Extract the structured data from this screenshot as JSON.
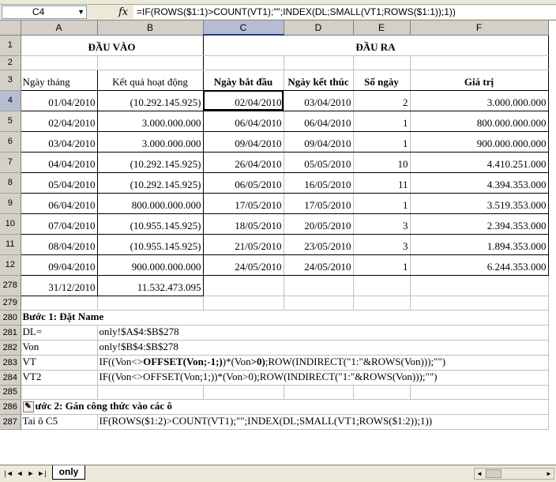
{
  "name_box": "C4",
  "formula_bar_prefix": "fx",
  "formula": "=IF(ROWS($1:1)>COUNT(VT1);\"\";INDEX(DL;SMALL(VT1;ROWS($1:1));1))",
  "columns": [
    "A",
    "B",
    "C",
    "D",
    "E",
    "F"
  ],
  "rows": {
    "r1": {
      "num": "1",
      "a_b": "ĐẦU VÀO",
      "c_f": "ĐẦU RA"
    },
    "r2": {
      "num": "2"
    },
    "r3": {
      "num": "3",
      "a": "Ngày tháng",
      "b": "Kết quả hoạt động",
      "c": "Ngày bắt đầu",
      "d": "Ngày kết thúc",
      "e": "Số ngày",
      "f": "Giá trị"
    },
    "data": [
      {
        "num": "4",
        "a": "01/04/2010",
        "b": "(10.292.145.925)",
        "c": "02/04/2010",
        "d": "03/04/2010",
        "e": "2",
        "f": "3.000.000.000"
      },
      {
        "num": "5",
        "a": "02/04/2010",
        "b": "3.000.000.000",
        "c": "06/04/2010",
        "d": "06/04/2010",
        "e": "1",
        "f": "800.000.000.000"
      },
      {
        "num": "6",
        "a": "03/04/2010",
        "b": "3.000.000.000",
        "c": "09/04/2010",
        "d": "09/04/2010",
        "e": "1",
        "f": "900.000.000.000"
      },
      {
        "num": "7",
        "a": "04/04/2010",
        "b": "(10.292.145.925)",
        "c": "26/04/2010",
        "d": "05/05/2010",
        "e": "10",
        "f": "4.410.251.000"
      },
      {
        "num": "8",
        "a": "05/04/2010",
        "b": "(10.292.145.925)",
        "c": "06/05/2010",
        "d": "16/05/2010",
        "e": "11",
        "f": "4.394.353.000"
      },
      {
        "num": "9",
        "a": "06/04/2010",
        "b": "800.000.000.000",
        "c": "17/05/2010",
        "d": "17/05/2010",
        "e": "1",
        "f": "3.519.353.000"
      },
      {
        "num": "10",
        "a": "07/04/2010",
        "b": "(10.955.145.925)",
        "c": "18/05/2010",
        "d": "20/05/2010",
        "e": "3",
        "f": "2.394.353.000"
      },
      {
        "num": "11",
        "a": "08/04/2010",
        "b": "(10.955.145.925)",
        "c": "21/05/2010",
        "d": "23/05/2010",
        "e": "3",
        "f": "1.894.353.000"
      },
      {
        "num": "12",
        "a": "09/04/2010",
        "b": "900.000.000.000",
        "c": "24/05/2010",
        "d": "24/05/2010",
        "e": "1",
        "f": "6.244.353.000"
      }
    ],
    "r278": {
      "num": "278",
      "a": "31/12/2010",
      "b": "11.532.473.095"
    },
    "r279": {
      "num": "279"
    },
    "r280": {
      "num": "280",
      "a": "Bước 1: Đặt Name"
    },
    "r281": {
      "num": "281",
      "a": "DL=",
      "b": "only!$A$4:$B$278"
    },
    "r282": {
      "num": "282",
      "a": "Von",
      "b": "only!$B$4:$B$278"
    },
    "r283": {
      "num": "283",
      "a": "VT",
      "b_pre": "IF((Von<>",
      "b_bold1": "OFFSET(Von;-1;)",
      "b_mid": ")*(Von",
      "b_bold2": ">0)",
      "b_post": ";ROW(INDIRECT(\"1:\"&ROWS(Von)));\"\")"
    },
    "r284": {
      "num": "284",
      "a": "VT2",
      "b": "IF((Von<>OFFSET(Von;1;))*(Von>0);ROW(INDIRECT(\"1:\"&ROWS(Von)));\"\")"
    },
    "r285": {
      "num": "285"
    },
    "r286": {
      "num": "286",
      "a": "ước 2: Gán công thức vào các ô"
    },
    "r287": {
      "num": "287",
      "a": "Tai ô C5",
      "b": "IF(ROWS($1:2)>COUNT(VT1);\"\";INDEX(DL;SMALL(VT1;ROWS($1:2));1))"
    }
  },
  "sheet_tab": "only"
}
